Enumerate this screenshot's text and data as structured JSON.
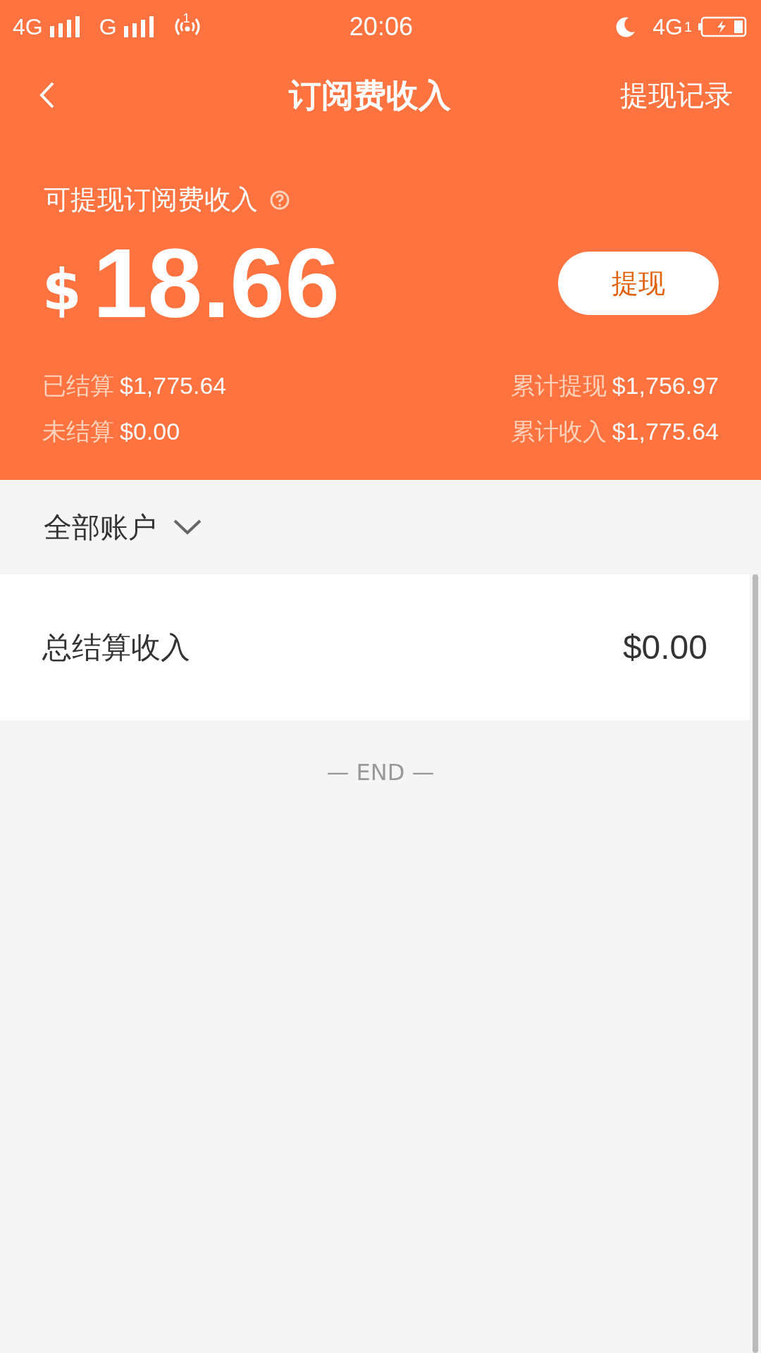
{
  "status_bar": {
    "network_1": "4G",
    "network_2": "G",
    "hotspot_sim": "1",
    "time": "20:06",
    "network_3": "4G",
    "sim": "1"
  },
  "nav": {
    "title": "订阅费收入",
    "action": "提现记录"
  },
  "balance": {
    "label": "可提现订阅费收入",
    "currency": "$",
    "amount": "18.66",
    "button": "提现"
  },
  "stats": [
    {
      "label": "已结算",
      "value": "$1,775.64"
    },
    {
      "label": "累计提现",
      "value": "$1,756.97"
    },
    {
      "label": "未结算",
      "value": "$0.00"
    },
    {
      "label": "累计收入",
      "value": "$1,775.64"
    }
  ],
  "account_filter": "全部账户",
  "summary": {
    "label": "总结算收入",
    "value": "$0.00"
  },
  "end_marker": "— END —"
}
